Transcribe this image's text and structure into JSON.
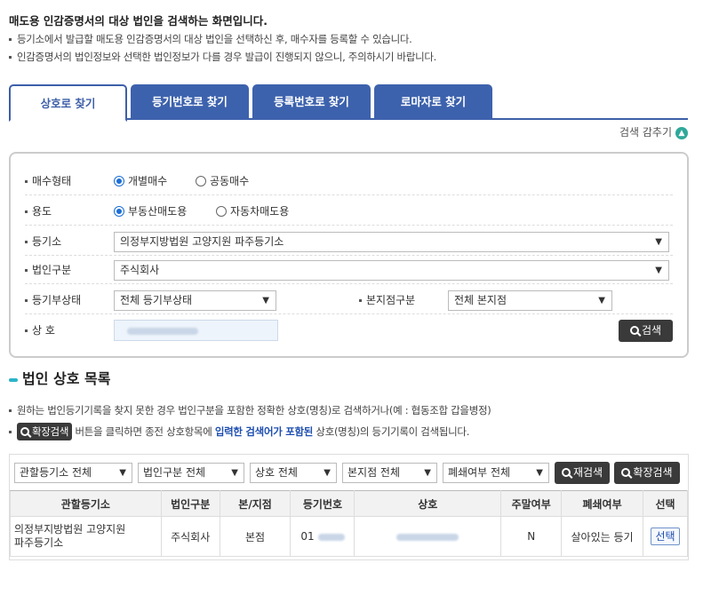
{
  "intro": {
    "title": "매도용 인감증명서의 대상 법인을 검색하는 화면입니다.",
    "lines": [
      "등기소에서 발급할 매도용 인감증명서의 대상 법인을 선택하신 후, 매수자를 등록할 수 있습니다.",
      "인감증명서의 법인정보와 선택한 법인정보가 다를 경우 발급이 진행되지 않으니, 주의하시기 바랍니다."
    ]
  },
  "tabs": [
    "상호로 찾기",
    "등기번호로 찾기",
    "등록번호로 찾기",
    "로마자로 찾기"
  ],
  "fold_label": "검색 감추기",
  "form": {
    "purchase_type": {
      "label": "매수형태",
      "options": [
        "개별매수",
        "공동매수"
      ],
      "selected": "개별매수"
    },
    "usage": {
      "label": "용도",
      "options": [
        "부동산매도용",
        "자동차매도용"
      ],
      "selected": "부동산매도용"
    },
    "registry": {
      "label": "등기소",
      "value": "의정부지방법원 고양지원 파주등기소"
    },
    "corp_type": {
      "label": "법인구분",
      "value": "주식회사"
    },
    "reg_status": {
      "label": "등기부상태",
      "value": "전체 등기부상태"
    },
    "branch_type": {
      "label": "본지점구분",
      "value": "전체 본지점"
    },
    "name": {
      "label": "상 호"
    },
    "search_button": "검색"
  },
  "results": {
    "title": "법인 상호 목록",
    "note1": "원하는 법인등기기록을 찾지 못한 경우 법인구분을 포함한 정확한 상호(명칭)로 검색하거나(예 : 협동조합 갑을병정)",
    "note2": {
      "chip": "확장검색",
      "pre": "버튼을 클릭하면 종전 상호항목에",
      "highlight": "입력한 검색어가 포함된",
      "post": "상호(명칭)의 등기기록이 검색됩니다."
    },
    "filters": [
      "관할등기소 전체",
      "법인구분 전체",
      "상호 전체",
      "본지점 전체",
      "폐쇄여부 전체"
    ],
    "research_button": "재검색",
    "extended_button": "확장검색",
    "columns": [
      "관할등기소",
      "법인구분",
      "본/지점",
      "등기번호",
      "상호",
      "주말여부",
      "폐쇄여부",
      "선택"
    ],
    "rows": [
      {
        "registry_line1": "의정부지방법원 고양지원",
        "registry_line2": "파주등기소",
        "corp_type": "주식회사",
        "branch": "본점",
        "reg_no": "01",
        "weekend": "N",
        "closed": "살아있는 등기",
        "select": "선택"
      }
    ]
  }
}
